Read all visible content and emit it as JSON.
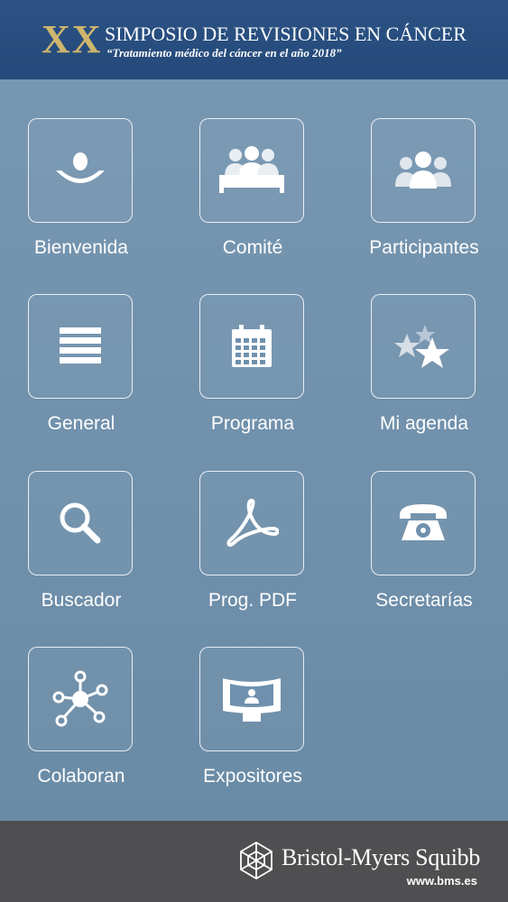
{
  "header": {
    "edition": "XX",
    "title": "SIMPOSIO DE REVISIONES EN CÁNCER",
    "subtitle": "“Tratamiento médico del cáncer en el año 2018”"
  },
  "menu": {
    "bienvenida": "Bienvenida",
    "comite": "Comité",
    "participantes": "Participantes",
    "general": "General",
    "programa": "Programa",
    "agenda": "Mi agenda",
    "buscador": "Buscador",
    "pdf": "Prog. PDF",
    "secretarias": "Secretarías",
    "colaboran": "Colaboran",
    "expositores": "Expositores"
  },
  "footer": {
    "brand": "Bristol-Myers Squibb",
    "url": "www.bms.es"
  },
  "colors": {
    "header_bg": "#2a5182",
    "body_bg": "#6f91ad",
    "footer_bg": "#4f4f51",
    "edition_gold": "#cfb56e"
  },
  "icons": [
    "welcome-icon",
    "committee-icon",
    "participants-icon",
    "list-icon",
    "calendar-icon",
    "stars-icon",
    "search-icon",
    "pdf-icon",
    "telephone-icon",
    "network-icon",
    "exhibitor-icon"
  ]
}
